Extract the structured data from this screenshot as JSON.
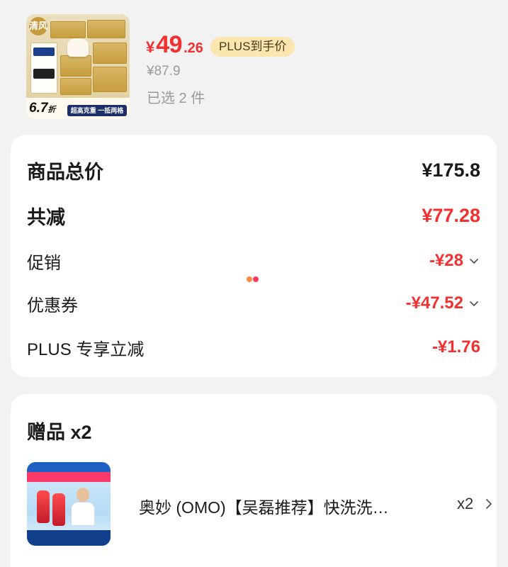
{
  "product": {
    "image_alt": "tissue paper product",
    "thumb_brand": "清风",
    "thumb_discount_value": "6.7",
    "thumb_discount_unit": "折",
    "thumb_slogan": "超高克重 一抵两格",
    "price_symbol": "¥",
    "price_int": "49",
    "price_dec": ".26",
    "plus_badge": "PLUS到手价",
    "original_price": "¥87.9",
    "selected_count": "已选 2 件"
  },
  "summary": {
    "total_label": "商品总价",
    "total_value": "¥175.8",
    "discount_label": "共减",
    "discount_value": "¥77.28",
    "promo_label": "促销",
    "promo_value": "-¥28",
    "coupon_label": "优惠券",
    "coupon_value": "-¥47.52",
    "plus_label": "PLUS 专享立减",
    "plus_value": "-¥1.76"
  },
  "gift": {
    "title": "赠品 x2",
    "name": "奥妙 (OMO)【吴磊推荐】快洗洗…",
    "quantity": "x2"
  },
  "colors": {
    "accent_red": "#f23030",
    "plus_badge_bg": "#fbe6b0",
    "muted_text": "#9a9a9a",
    "loader_orange": "#ff8a3d",
    "loader_red": "#ff3b5c"
  },
  "icons": {
    "promo_chevron": "chevron-down-icon",
    "coupon_chevron": "chevron-down-icon",
    "gift_chevron": "chevron-right-icon",
    "loading": "loading-dots-icon"
  }
}
